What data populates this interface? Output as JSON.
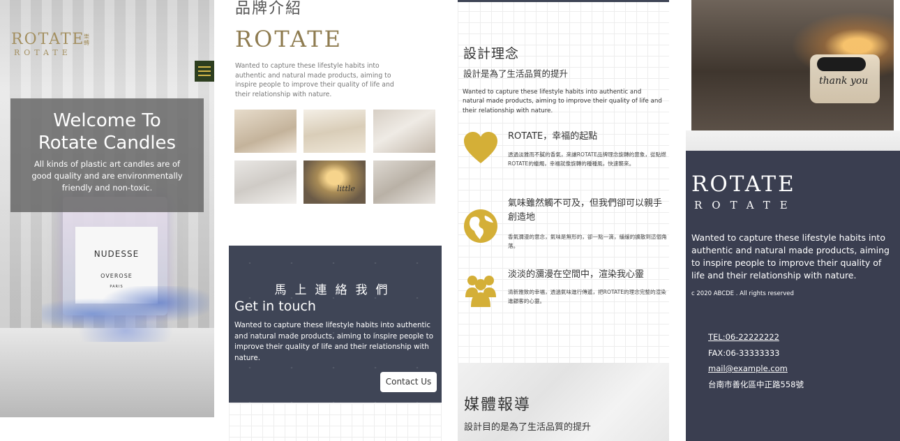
{
  "hero": {
    "logo_main": "ROTATE",
    "logo_sub": "ROTATE",
    "logo_cn": "樂轉",
    "title_line1": "Welcome To",
    "title_line2": "Rotate Candles",
    "description": "All kinds of plastic art candles are of good quality and are environmentally friendly and non-toxic.",
    "product_name": "NUDESSE",
    "product_scent": "OVEROSE",
    "product_city": "PARIS"
  },
  "brand": {
    "heading": "品牌介紹",
    "logo": "ROTATE",
    "description": "Wanted to capture these lifestyle habits into authentic and natural made products, aiming to inspire people to improve their quality of life and their relationship with nature.",
    "gallery_candle_text": "little"
  },
  "contact": {
    "heading_zh": "馬上連絡我們",
    "heading_en": "Get in touch",
    "description": "Wanted to capture these lifestyle habits into authentic and natural made products, aiming to inspire people to improve their quality of life and their relationship with nature.",
    "button_label": "Contact Us"
  },
  "design": {
    "heading": "設計理念",
    "subheading": "設計是為了生活品質的提升",
    "description": "Wanted to capture these lifestyle habits into authentic and natural made products, aiming to improve their quality of life and their relationship with nature.",
    "features": [
      {
        "icon": "heart-icon",
        "title": "ROTATE，幸福的起點",
        "text": "透過淡雅而不膩的香氣，來讓ROTATE品牌理念旋轉的意象，從點燃ROTATE的蠟燭，幸福就像旋轉的種種風，快速襲來。"
      },
      {
        "icon": "globe-icon",
        "title": "氣味雖然觸不可及，但我們卻可以親手創造地",
        "text": "香氣瀰漫的意念，氣味是無形的，卻一點一滴，緩緩的擴散到這個角落。"
      },
      {
        "icon": "people-icon",
        "title": "淡淡的瀰漫在空間中，渲染我心靈",
        "text": "清新雅致的幸福，透過氣味進行傳遞，把ROTATE的理念完整的渲染進顧客的心靈。"
      }
    ]
  },
  "media": {
    "heading": "媒體報導",
    "subheading": "設計目的是為了生活品質的提升"
  },
  "footer": {
    "photo_text": "thank you",
    "logo_main": "ROTATE",
    "logo_sub": "ROTATE",
    "description": "Wanted to capture these lifestyle habits into authentic and natural made products, aiming to inspire people to improve their quality of life and their relationship with nature.",
    "copyright": "c 2020 ABCDE . All rights reserved",
    "tel": "TEL:06-22222222",
    "fax": "FAX:06-33333333",
    "email": "mail@example.com",
    "address": "台南市善化區中正路558號"
  },
  "colors": {
    "gold": "#d4af37",
    "navy": "#3a3e50",
    "logo_gold": "#8e7b4f"
  }
}
